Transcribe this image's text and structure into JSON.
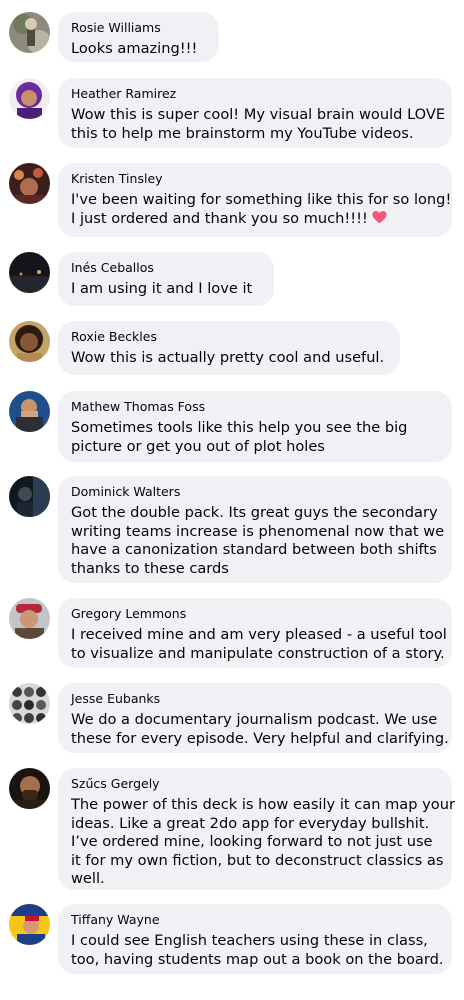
{
  "comments": [
    {
      "author": "Rosie Williams",
      "text": "Looks amazing!!!",
      "avatar": "rosie-williams-avatar"
    },
    {
      "author": "Heather Ramirez",
      "text": "Wow this is super cool! My visual brain would LOVE\nthis to help me brainstorm my YouTube videos.",
      "avatar": "heather-ramirez-avatar"
    },
    {
      "author": "Kristen Tinsley",
      "text": "I've been waiting for something like this for so long!\nI just ordered and thank you so much!!!!",
      "emoji": "heart-icon",
      "avatar": "kristen-tinsley-avatar"
    },
    {
      "author": "Inés Ceballos",
      "text": "I am using it and I love it",
      "avatar": "ines-ceballos-avatar"
    },
    {
      "author": "Roxie Beckles",
      "text": "Wow this is actually pretty cool and useful.",
      "avatar": "roxie-beckles-avatar"
    },
    {
      "author": "Mathew Thomas Foss",
      "text": "Sometimes tools like this help you see the big\npicture or get you out of plot holes",
      "avatar": "mathew-thomas-foss-avatar"
    },
    {
      "author": "Dominick Walters",
      "text": "Got the double pack. Its great guys the secondary\nwriting teams increase is phenomenal now that we\nhave a canonization standard between both shifts\nthanks to these cards",
      "avatar": "dominick-walters-avatar"
    },
    {
      "author": "Gregory Lemmons",
      "text": "I received mine and am very pleased - a useful tool\nto visualize and manipulate construction of a story.",
      "avatar": "gregory-lemmons-avatar"
    },
    {
      "author": "Jesse Eubanks",
      "text": "We do a documentary journalism podcast. We use\nthese for every episode. Very helpful and clarifying.",
      "avatar": "jesse-eubanks-avatar"
    },
    {
      "author": "Szűcs Gergely",
      "text": "The power of this deck is how easily it can map your\nideas. Like a great 2do app for everyday bullshit.\nI’ve ordered mine, looking forward to not just use\nit for my own fiction, but to deconstruct classics as\nwell.",
      "avatar": "szucs-gergely-avatar"
    },
    {
      "author": "Tiffany Wayne",
      "text": "I could see English teachers using these in class,\ntoo, having students map out a book on the board.",
      "avatar": "tiffany-wayne-avatar"
    }
  ],
  "colors": {
    "bubble": "#eff1f4",
    "text": "#050505",
    "heart": "#f4577a"
  }
}
